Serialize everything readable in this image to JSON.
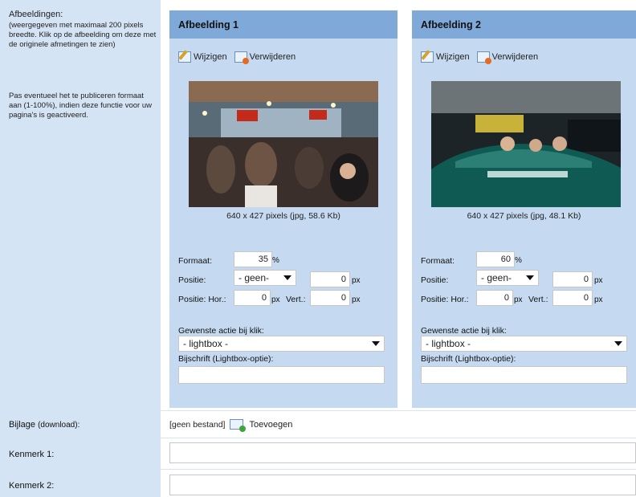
{
  "help": {
    "title": "Afbeeldingen:",
    "description": "(weergegeven met maximaal 200 pixels breedte. Klik op de afbeelding om deze met de originele afmetingen te zien)",
    "format_note": "Pas eventueel het te publiceren formaat aan (1-100%), indien deze functie voor uw pagina's is geactiveerd."
  },
  "images": [
    {
      "title": "Afbeelding 1",
      "edit_label": "Wijzigen",
      "delete_label": "Verwijderen",
      "info": "640 x 427 pixels (jpg, 58.6 Kb)",
      "format_label": "Formaat:",
      "format_value": "35",
      "percent": "%",
      "position_label": "Positie:",
      "position_select": "- geen-",
      "position_value": "0",
      "px": "px",
      "hor_label": "Positie: Hor.:",
      "hor_value": "0",
      "vert_label": "Vert.:",
      "vert_value": "0",
      "click_action_label": "Gewenste actie bij klik:",
      "click_action_value": "- lightbox -",
      "caption_label": "Bijschrift (Lightbox-optie):",
      "caption_value": ""
    },
    {
      "title": "Afbeelding 2",
      "edit_label": "Wijzigen",
      "delete_label": "Verwijderen",
      "info": "640 x 427 pixels (jpg, 48.1 Kb)",
      "format_label": "Formaat:",
      "format_value": "60",
      "percent": "%",
      "position_label": "Positie:",
      "position_select": "- geen-",
      "position_value": "0",
      "px": "px",
      "hor_label": "Positie: Hor.:",
      "hor_value": "0",
      "vert_label": "Vert.:",
      "vert_value": "0",
      "click_action_label": "Gewenste actie bij klik:",
      "click_action_value": "- lightbox -",
      "caption_label": "Bijschrift (Lightbox-optie):",
      "caption_value": ""
    }
  ],
  "attachment": {
    "label": "Bijlage",
    "label_suffix": "(download):",
    "status": "[geen bestand]",
    "add_label": "Toevoegen"
  },
  "fields": [
    {
      "label": "Kenmerk 1:",
      "value": ""
    },
    {
      "label": "Kenmerk 2:",
      "value": ""
    }
  ]
}
